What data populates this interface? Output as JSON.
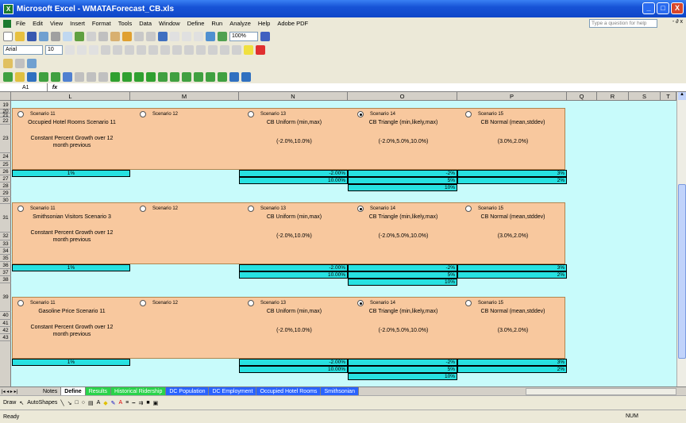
{
  "window": {
    "title": "Microsoft Excel - WMATAForecast_CB.xls",
    "app_icon": "excel-icon",
    "controls": [
      "_",
      "□",
      "X"
    ]
  },
  "menu": {
    "items": [
      "File",
      "Edit",
      "View",
      "Insert",
      "Format",
      "Tools",
      "Data",
      "Window",
      "Define",
      "Run",
      "Analyze",
      "Help",
      "Adobe PDF"
    ],
    "help_placeholder": "Type a question for help",
    "doc_controls": "- ∂ x"
  },
  "toolbar": {
    "font_name": "Arial",
    "font_size": "10",
    "zoom": "100%"
  },
  "formula_bar": {
    "name_box": "A1",
    "fx": "fx",
    "content": ""
  },
  "columns": [
    "L",
    "M",
    "N",
    "O",
    "P",
    "Q",
    "R",
    "S",
    "T"
  ],
  "rows": [
    "19",
    "20",
    "21",
    "22",
    "23",
    "24",
    "25",
    "26",
    "27",
    "28",
    "29",
    "30",
    "31",
    "32",
    "33",
    "34",
    "35",
    "36",
    "37",
    "38",
    "39",
    "40",
    "41",
    "42",
    "43"
  ],
  "blocks": [
    {
      "title": "Occupied Hotel Rooms Scenario 11",
      "scenarios": [
        {
          "label": "Scenario 11",
          "selected": false
        },
        {
          "label": "Scenario 12",
          "selected": false
        },
        {
          "label": "Scenario 13",
          "selected": false
        },
        {
          "label": "Scenario 14",
          "selected": true
        },
        {
          "label": "Scenario 15",
          "selected": false
        }
      ],
      "growth_text_1": "Constant Percent Growth over 12",
      "growth_text_2": "month previous",
      "n_head": "CB Uniform (min,max)",
      "n_params": "(-2.0%,10.0%)",
      "o_head": "CB Triangle (min,likely,max)",
      "o_params": "(-2.0%,5.0%,10.0%)",
      "p_head": "CB Normal (mean,stddev)",
      "p_params": "(3.0%,2.0%)",
      "l_val": "1%",
      "n_vals": [
        "-2.00%",
        "10.00%"
      ],
      "o_vals": [
        "-2%",
        "5%",
        "10%"
      ],
      "p_vals": [
        "3%",
        "2%"
      ]
    },
    {
      "title": "Smithsonian Visitors Scenario 3",
      "scenarios": [
        {
          "label": "Scenario 11",
          "selected": false
        },
        {
          "label": "Scenario 12",
          "selected": false
        },
        {
          "label": "Scenario 13",
          "selected": false
        },
        {
          "label": "Scenario 14",
          "selected": true
        },
        {
          "label": "Scenario 15",
          "selected": false
        }
      ],
      "growth_text_1": "Constant Percent Growth over 12",
      "growth_text_2": "month previous",
      "n_head": "CB Uniform (min,max)",
      "n_params": "(-2.0%,10.0%)",
      "o_head": "CB Triangle (min,likely,max)",
      "o_params": "(-2.0%,5.0%,10.0%)",
      "p_head": "CB Normal (mean,stddev)",
      "p_params": "(3.0%,2.0%)",
      "l_val": "1%",
      "n_vals": [
        "-2.00%",
        "10.00%"
      ],
      "o_vals": [
        "-2%",
        "5%",
        "10%"
      ],
      "p_vals": [
        "3%",
        "2%"
      ]
    },
    {
      "title": "Gasoline Price Scenario 11",
      "scenarios": [
        {
          "label": "Scenario 11",
          "selected": false
        },
        {
          "label": "Scenario 12",
          "selected": false
        },
        {
          "label": "Scenario 13",
          "selected": false
        },
        {
          "label": "Scenario 14",
          "selected": true
        },
        {
          "label": "Scenario 15",
          "selected": false
        }
      ],
      "growth_text_1": "Constant Percent Growth over 12",
      "growth_text_2": "month previous",
      "n_head": "CB Uniform (min,max)",
      "n_params": "(-2.0%,10.0%)",
      "o_head": "CB Triangle (min,likely,max)",
      "o_params": "(-2.0%,5.0%,10.0%)",
      "p_head": "CB Normal (mean,stddev)",
      "p_params": "(3.0%,2.0%)",
      "l_val": "1%",
      "n_vals": [
        "-2.00%",
        "10.00%"
      ],
      "o_vals": [
        "-2%",
        "5%",
        "10%"
      ],
      "p_vals": [
        "3%",
        "2%"
      ]
    }
  ],
  "tabs": [
    {
      "label": "Notes",
      "style": "plain"
    },
    {
      "label": "Define",
      "style": "active"
    },
    {
      "label": "Results",
      "style": "green"
    },
    {
      "label": "Historical Ridership",
      "style": "green"
    },
    {
      "label": "DC Population",
      "style": "blue"
    },
    {
      "label": "DC Employment",
      "style": "blue"
    },
    {
      "label": "Occupied Hotel Rooms",
      "style": "blue"
    },
    {
      "label": "Smithsonian",
      "style": "blue"
    }
  ],
  "drawbar": {
    "draw": "Draw",
    "autoshapes": "AutoShapes"
  },
  "status": {
    "left": "Ready",
    "num": "NUM"
  },
  "colors": {
    "panel": "#f8c89e",
    "cell": "#27e1e1",
    "sheet_bg": "#c8fbfb"
  }
}
